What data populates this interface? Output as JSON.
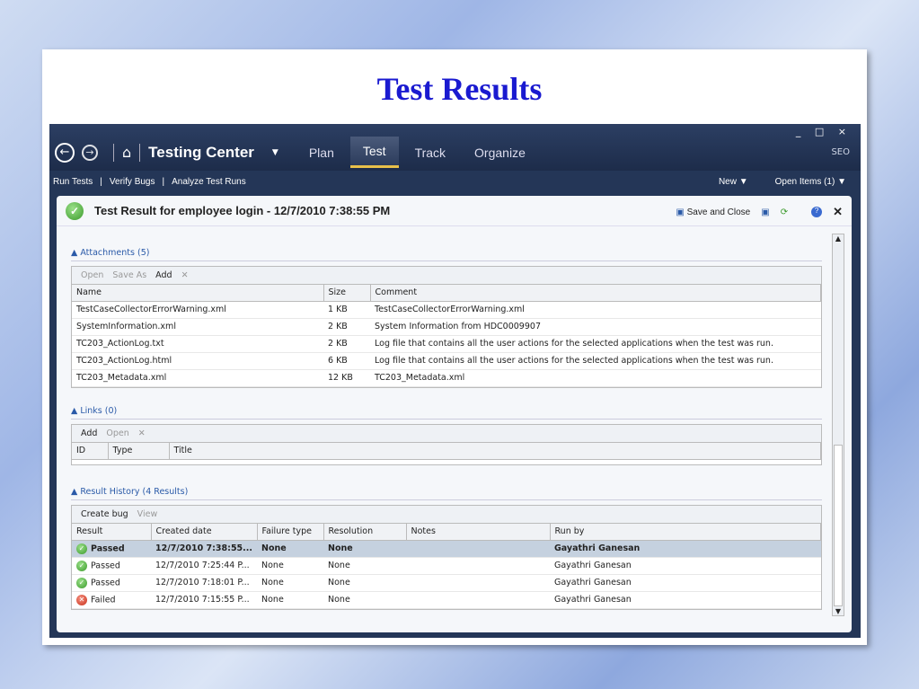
{
  "slide_title": "Test Results",
  "header": {
    "app_name": "Testing Center",
    "tabs": [
      "Plan",
      "Test",
      "Track",
      "Organize"
    ],
    "active_tab": "Test",
    "window_controls": "_ □ ×",
    "user": "SEO"
  },
  "subnav": {
    "links": [
      "Run Tests",
      "Verify Bugs",
      "Analyze Test Runs"
    ],
    "right": [
      "New ▼",
      "Open Items (1) ▼"
    ]
  },
  "document": {
    "title": "Test Result for employee login - 12/7/2010 7:38:55 PM",
    "save_close": "Save and Close"
  },
  "attachments": {
    "label": "Attachments (5)",
    "toolbar": [
      "Open",
      "Save As",
      "Add"
    ],
    "columns": [
      "Name",
      "Size",
      "Comment"
    ],
    "rows": [
      [
        "TestCaseCollectorErrorWarning.xml",
        "1 KB",
        "TestCaseCollectorErrorWarning.xml"
      ],
      [
        "SystemInformation.xml",
        "2 KB",
        "System Information from HDC0009907"
      ],
      [
        "TC203_ActionLog.txt",
        "2 KB",
        "Log file that contains all the user actions for the selected applications when the test was run."
      ],
      [
        "TC203_ActionLog.html",
        "6 KB",
        "Log file that contains all the user actions for the selected applications when the test was run."
      ],
      [
        "TC203_Metadata.xml",
        "12 KB",
        "TC203_Metadata.xml"
      ]
    ]
  },
  "links": {
    "label": "Links (0)",
    "toolbar": [
      "Add",
      "Open"
    ],
    "columns": [
      "ID",
      "Type",
      "Title"
    ]
  },
  "history": {
    "label": "Result History (4 Results)",
    "toolbar": [
      "Create bug",
      "View"
    ],
    "columns": [
      "Result",
      "Created date",
      "Failure type",
      "Resolution",
      "Notes",
      "Run by"
    ],
    "rows": [
      [
        "Passed",
        "12/7/2010 7:38:55...",
        "None",
        "None",
        "",
        "Gayathri Ganesan"
      ],
      [
        "Passed",
        "12/7/2010 7:25:44 P...",
        "None",
        "None",
        "",
        "Gayathri Ganesan"
      ],
      [
        "Passed",
        "12/7/2010 7:18:01 P...",
        "None",
        "None",
        "",
        "Gayathri Ganesan"
      ],
      [
        "Failed",
        "12/7/2010 7:15:55 P...",
        "None",
        "None",
        "",
        "Gayathri Ganesan"
      ]
    ]
  }
}
